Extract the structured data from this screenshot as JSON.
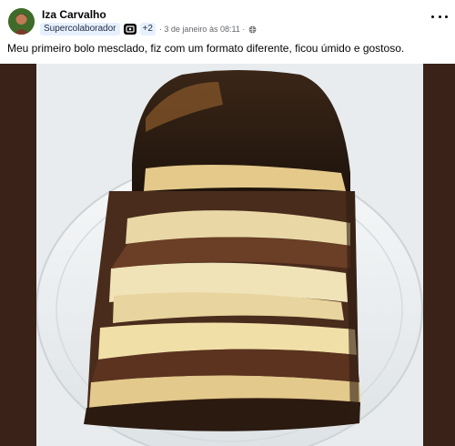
{
  "post": {
    "author": "Iza Carvalho",
    "badge": "Supercolaborador",
    "badge_icon": "community-badge-icon",
    "badge_count": "+2",
    "timestamp": "· 3 de janeiro às 08:11 ·",
    "privacy_icon": "globe-icon",
    "more_icon": "more-options-icon",
    "text": "Meu primeiro bolo mesclado, fiz com um formato diferente, ficou úmido e gostoso."
  },
  "media": {
    "subject": "marble-cake-photo",
    "background_color": "#3a2219"
  }
}
